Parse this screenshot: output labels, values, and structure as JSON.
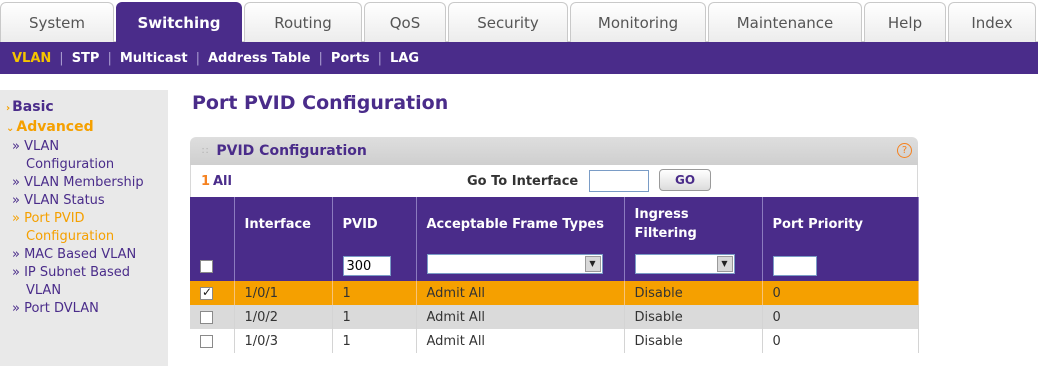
{
  "top_tabs": [
    {
      "label": "System",
      "active": false
    },
    {
      "label": "Switching",
      "active": true
    },
    {
      "label": "Routing",
      "active": false
    },
    {
      "label": "QoS",
      "active": false
    },
    {
      "label": "Security",
      "active": false
    },
    {
      "label": "Monitoring",
      "active": false
    },
    {
      "label": "Maintenance",
      "active": false
    },
    {
      "label": "Help",
      "active": false
    },
    {
      "label": "Index",
      "active": false
    }
  ],
  "sub_nav": [
    {
      "label": "VLAN",
      "active": true
    },
    {
      "label": "STP",
      "active": false
    },
    {
      "label": "Multicast",
      "active": false
    },
    {
      "label": "Address Table",
      "active": false
    },
    {
      "label": "Ports",
      "active": false
    },
    {
      "label": "LAG",
      "active": false
    }
  ],
  "sidebar": {
    "basic": "Basic",
    "advanced": "Advanced",
    "items": [
      {
        "label": "» VLAN",
        "active": false
      },
      {
        "label": "Configuration",
        "active": false
      },
      {
        "label": "» VLAN Membership",
        "active": false
      },
      {
        "label": "» VLAN Status",
        "active": false
      },
      {
        "label": "» Port PVID",
        "active": true
      },
      {
        "label": "Configuration",
        "active": true
      },
      {
        "label": "» MAC Based VLAN",
        "active": false
      },
      {
        "label": "» IP Subnet Based",
        "active": false
      },
      {
        "label": "VLAN",
        "active": false
      },
      {
        "label": "» Port DVLAN",
        "active": false
      }
    ]
  },
  "page_title": "Port PVID Configuration",
  "panel": {
    "title": "PVID Configuration",
    "help": "?",
    "page_number": "1",
    "page_all": "All",
    "goto_label": "Go To Interface",
    "goto_value": "",
    "go_button": "GO"
  },
  "table": {
    "headers": [
      "",
      "Interface",
      "PVID",
      "Acceptable Frame Types",
      "Ingress Filtering",
      "Port Priority"
    ],
    "edit_row": {
      "pvid": "300",
      "frame_types": "",
      "ingress": "",
      "priority": ""
    },
    "rows": [
      {
        "checked": true,
        "interface": "1/0/1",
        "pvid": "1",
        "frame_types": "Admit All",
        "ingress": "Disable",
        "priority": "0"
      },
      {
        "checked": false,
        "interface": "1/0/2",
        "pvid": "1",
        "frame_types": "Admit All",
        "ingress": "Disable",
        "priority": "0"
      },
      {
        "checked": false,
        "interface": "1/0/3",
        "pvid": "1",
        "frame_types": "Admit All",
        "ingress": "Disable",
        "priority": "0"
      }
    ]
  },
  "colors": {
    "brand_purple": "#4a2c8a",
    "accent_orange": "#f5a000",
    "help_orange": "#f58220"
  }
}
